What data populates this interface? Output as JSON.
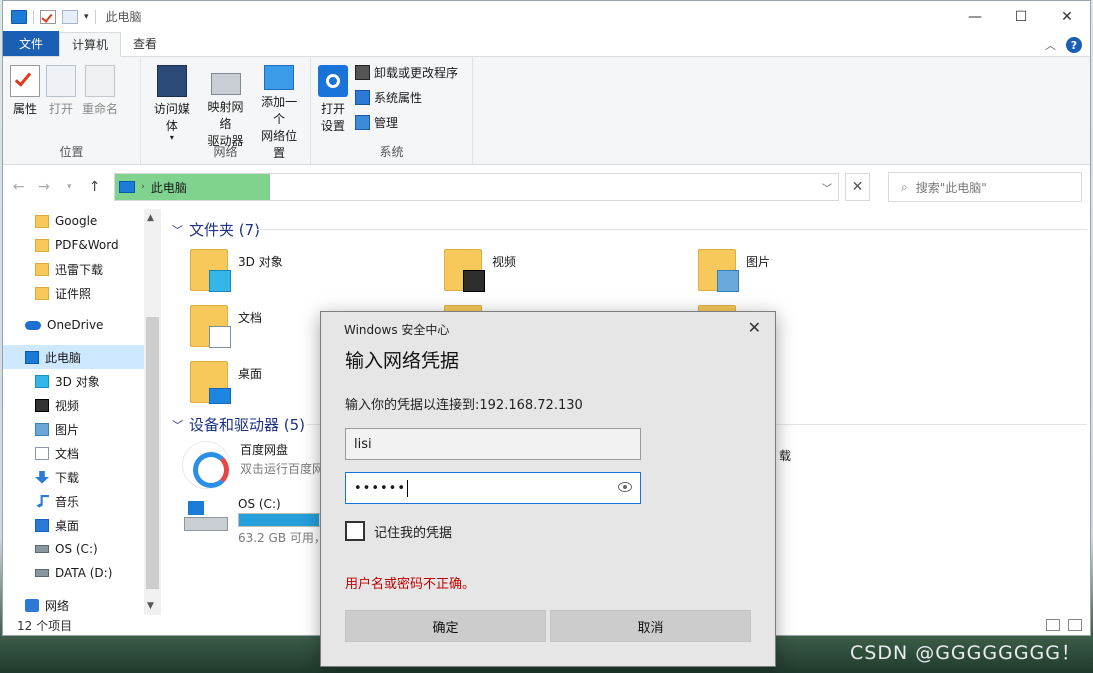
{
  "window": {
    "title": "此电脑",
    "controls": {
      "minimize": "—",
      "maximize": "☐",
      "close": "✕"
    }
  },
  "ribbon": {
    "tabs": [
      {
        "label": "文件"
      },
      {
        "label": "计算机"
      },
      {
        "label": "查看"
      }
    ],
    "location_group": {
      "label": "位置",
      "buttons": [
        "属性",
        "打开",
        "重命名"
      ]
    },
    "network_group": {
      "label": "网络",
      "media_label": "访问媒体",
      "map_label_1": "映射网络",
      "map_label_2": "驱动器",
      "addloc_label_1": "添加一个",
      "addloc_label_2": "网络位置"
    },
    "system_group": {
      "label": "系统",
      "settings_label_1": "打开",
      "settings_label_2": "设置",
      "uninstall": "卸载或更改程序",
      "sysprops": "系统属性",
      "manage": "管理"
    }
  },
  "address": {
    "crumb": "此电脑",
    "search_placeholder": "搜索\"此电脑\""
  },
  "nav": {
    "quick": [
      {
        "label": "Google"
      },
      {
        "label": "PDF&Word"
      },
      {
        "label": "迅雷下载"
      },
      {
        "label": "证件照"
      }
    ],
    "onedrive": "OneDrive",
    "thispc": "此电脑",
    "pc_items": [
      {
        "label": "3D 对象",
        "icon": "cube"
      },
      {
        "label": "视频",
        "icon": "film"
      },
      {
        "label": "图片",
        "icon": "pic"
      },
      {
        "label": "文档",
        "icon": "doc"
      },
      {
        "label": "下载",
        "icon": "dl"
      },
      {
        "label": "音乐",
        "icon": "music"
      },
      {
        "label": "桌面",
        "icon": "desk"
      },
      {
        "label": "OS (C:)",
        "icon": "drv"
      },
      {
        "label": "DATA (D:)",
        "icon": "drv"
      }
    ],
    "network": "网络"
  },
  "content": {
    "folders_header": "文件夹 (7)",
    "folders": [
      {
        "name": "3D 对象"
      },
      {
        "name": "视频"
      },
      {
        "name": "图片"
      },
      {
        "name": "文档"
      },
      {
        "name": "桌面"
      }
    ],
    "devices_header": "设备和驱动器 (5)",
    "baidu": {
      "name": "百度网盘",
      "sub": "双击运行百度网盘"
    },
    "osdrive": {
      "name": "OS (C:)",
      "sub": "63.2 GB 可用，",
      "fill_fraction": 0.95
    },
    "partial_right": "载"
  },
  "status": {
    "count": "12 个项目"
  },
  "dialog": {
    "title": "Windows 安全中心",
    "heading": "输入网络凭据",
    "description": "输入你的凭据以连接到:192.168.72.130",
    "username": "lisi",
    "password_mask": "••••••",
    "remember": "记住我的凭据",
    "error": "用户名或密码不正确。",
    "ok": "确定",
    "cancel": "取消",
    "error_color": "#c00000"
  },
  "watermark": "CSDN @GGGGGGGG！"
}
